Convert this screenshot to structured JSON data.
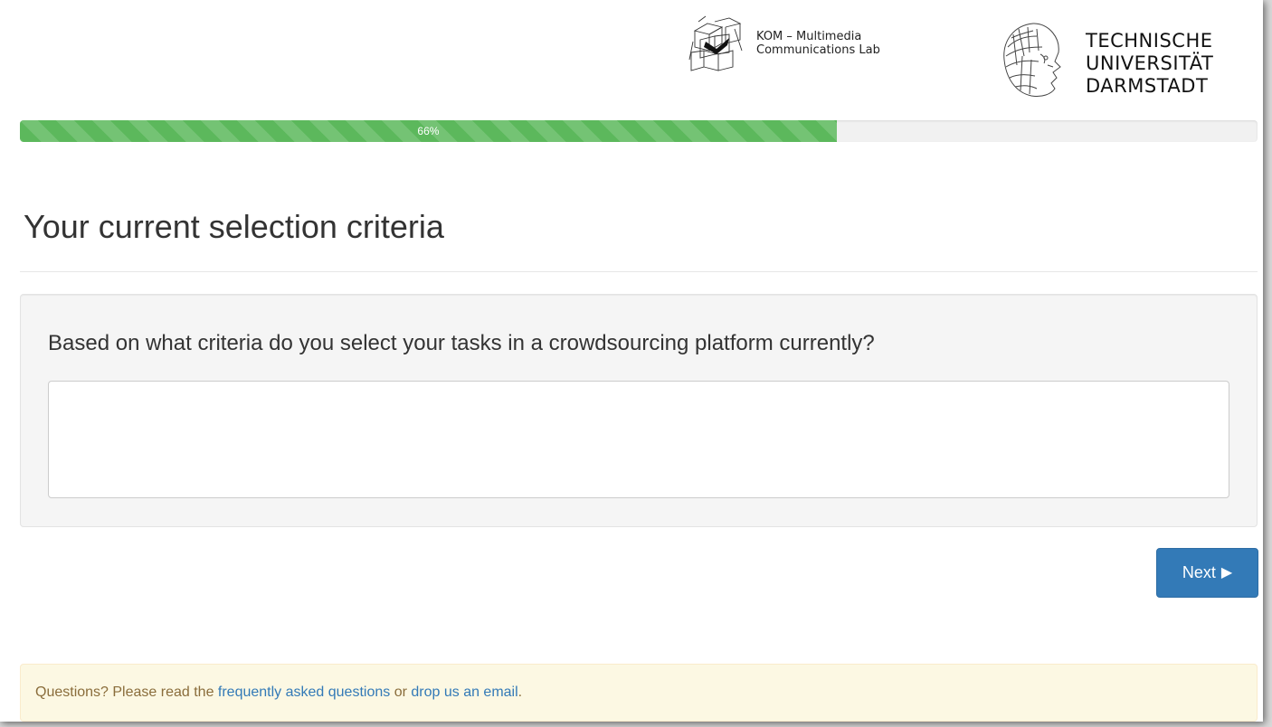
{
  "header": {
    "kom_logo_icon": "kom-cube-logo-icon",
    "kom_line1": "KOM – Multimedia",
    "kom_line2": "Communications Lab",
    "tud_logo_icon": "athena-head-logo-icon",
    "tud_line1": "TECHNISCHE",
    "tud_line2": "UNIVERSITÄT",
    "tud_line3": "DARMSTADT"
  },
  "progress": {
    "value_percent": 66,
    "label": "66%",
    "color": "#5cb85c"
  },
  "page": {
    "title": "Your current selection criteria"
  },
  "question": {
    "label": "Based on what criteria do you select your tasks in a crowdsourcing platform currently?",
    "answer_value": "",
    "answer_placeholder": ""
  },
  "next_button": {
    "label": "Next",
    "icon": "play-triangle-icon",
    "color": "#337ab7"
  },
  "footer": {
    "text_before": "Questions? Please read the ",
    "faq_link": "frequently asked questions",
    "text_middle": " or ",
    "email_link": "drop us an email",
    "text_after": "."
  }
}
